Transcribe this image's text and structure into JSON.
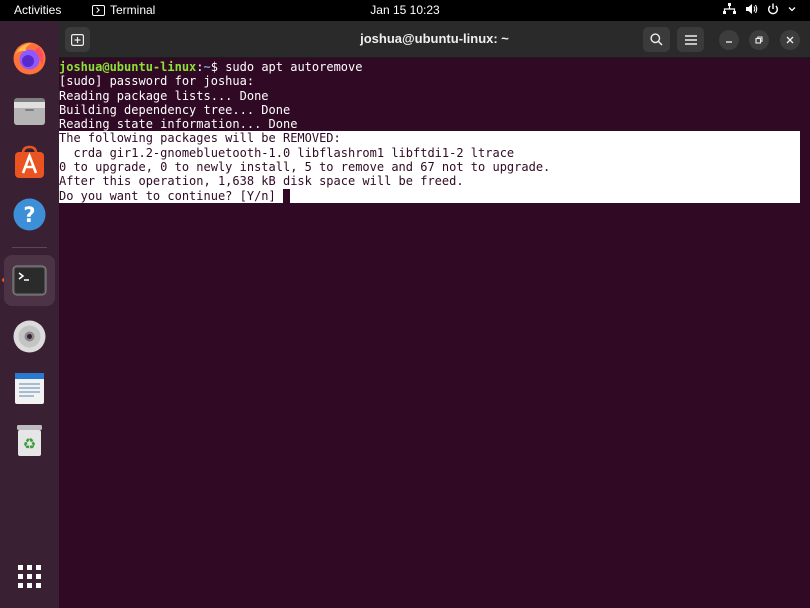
{
  "topbar": {
    "activities": "Activities",
    "app_name": "Terminal",
    "clock": "Jan 15  10:23"
  },
  "dock": {
    "items": [
      {
        "name": "Firefox"
      },
      {
        "name": "Files"
      },
      {
        "name": "Ubuntu Software"
      },
      {
        "name": "Help"
      },
      {
        "name": "Terminal",
        "active": true
      },
      {
        "name": "Disc"
      },
      {
        "name": "Text Editor"
      },
      {
        "name": "Trash"
      },
      {
        "name": "Show Applications"
      }
    ]
  },
  "window": {
    "title": "joshua@ubuntu-linux: ~"
  },
  "terminal": {
    "prompt_user": "joshua@ubuntu-linux",
    "prompt_sep": ":",
    "prompt_path": "~",
    "prompt_symbol": "$ ",
    "command": "sudo apt autoremove",
    "lines": [
      "[sudo] password for joshua:",
      "Reading package lists... Done",
      "Building dependency tree... Done",
      "Reading state information... Done"
    ],
    "selected_lines": [
      "The following packages will be REMOVED:",
      "  crda gir1.2-gnomebluetooth-1.0 libflashrom1 libftdi1-2 ltrace",
      "0 to upgrade, 0 to newly install, 5 to remove and 67 not to upgrade.",
      "After this operation, 1,638 kB disk space will be freed."
    ],
    "question": "Do you want to continue? [Y/n] "
  },
  "colors": {
    "terminal_bg": "#300a24",
    "prompt_user": "#8ae234",
    "prompt_path": "#729fcf",
    "accent": "#e95420"
  }
}
